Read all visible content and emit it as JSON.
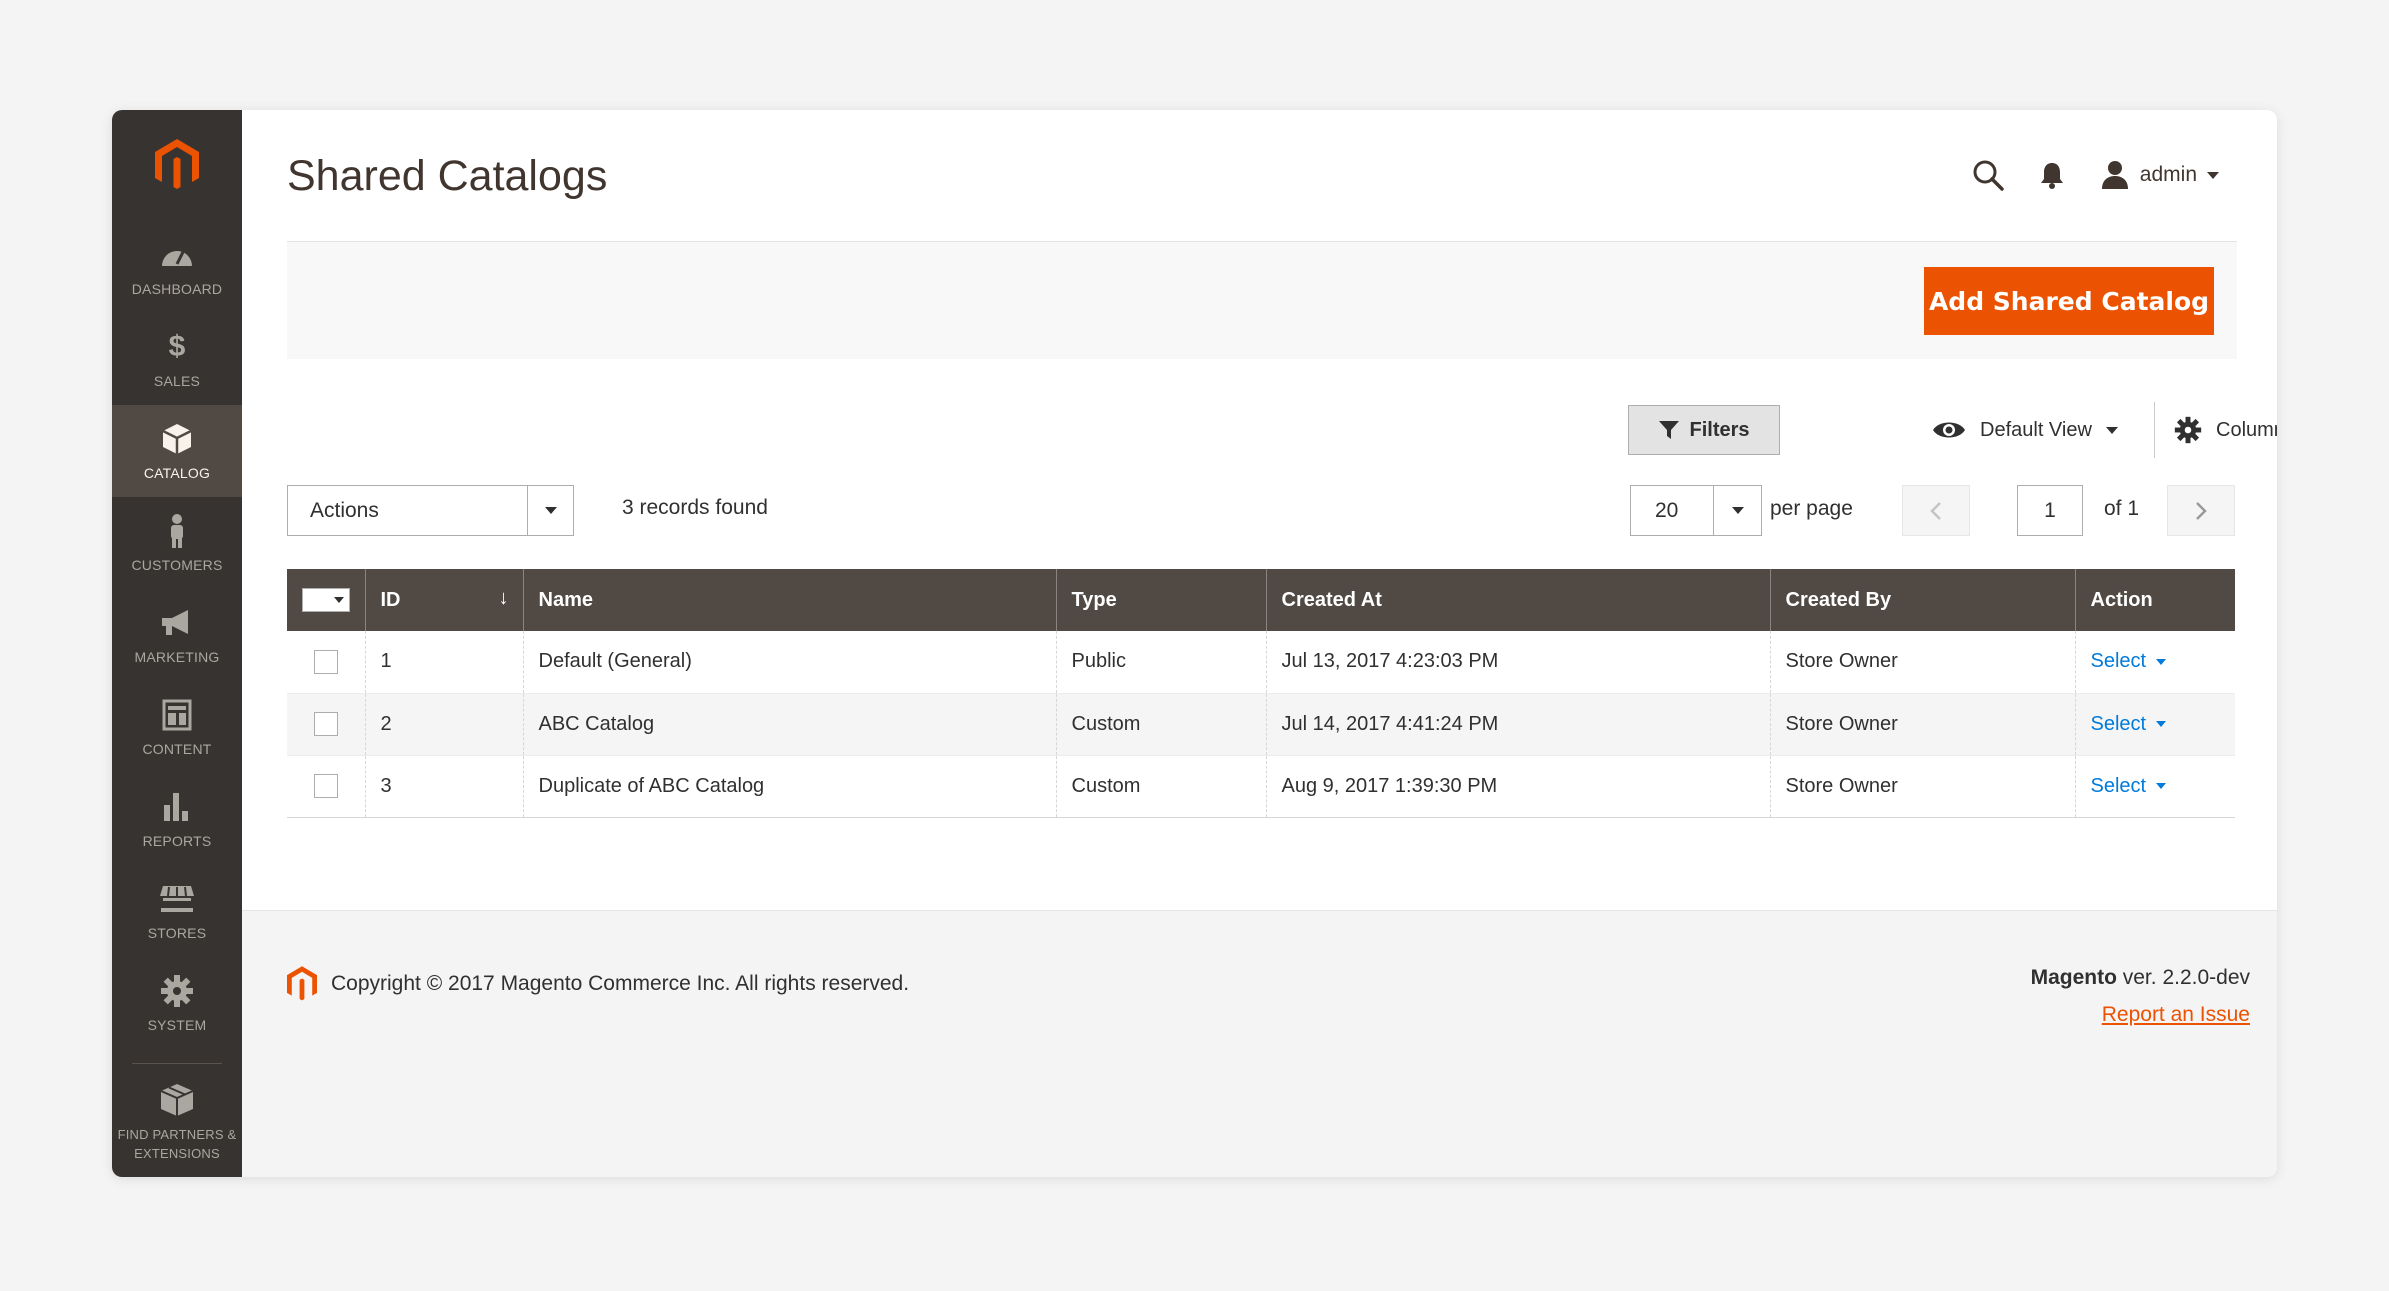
{
  "page": {
    "title": "Shared Catalogs"
  },
  "header": {
    "user": "admin"
  },
  "sidebar": {
    "items": [
      {
        "label": "Dashboard",
        "icon": "dashboard-icon"
      },
      {
        "label": "Sales",
        "icon": "dollar-icon"
      },
      {
        "label": "Catalog",
        "icon": "box-icon",
        "active": true
      },
      {
        "label": "Customers",
        "icon": "person-icon"
      },
      {
        "label": "Marketing",
        "icon": "megaphone-icon"
      },
      {
        "label": "Content",
        "icon": "layout-icon"
      },
      {
        "label": "Reports",
        "icon": "bar-chart-icon"
      },
      {
        "label": "Stores",
        "icon": "storefront-icon"
      },
      {
        "label": "System",
        "icon": "gear-icon"
      },
      {
        "label": "Find Partners & Extensions",
        "icon": "cubes-icon"
      }
    ]
  },
  "toolbar": {
    "add_button": "Add Shared Catalog",
    "filters": "Filters",
    "default_view": "Default View",
    "columns": "Columns",
    "actions": "Actions",
    "records_found": "3 records found",
    "per_page_value": "20",
    "per_page_label": "per page",
    "current_page": "1",
    "page_of": "of 1"
  },
  "grid": {
    "columns": [
      "ID",
      "Name",
      "Type",
      "Created At",
      "Created By",
      "Action"
    ],
    "rows": [
      {
        "id": "1",
        "name": "Default (General)",
        "type": "Public",
        "created_at": "Jul 13, 2017 4:23:03 PM",
        "created_by": "Store Owner",
        "action": "Select"
      },
      {
        "id": "2",
        "name": "ABC Catalog",
        "type": "Custom",
        "created_at": "Jul 14, 2017 4:41:24 PM",
        "created_by": "Store Owner",
        "action": "Select"
      },
      {
        "id": "3",
        "name": "Duplicate of ABC Catalog",
        "type": "Custom",
        "created_at": "Aug 9, 2017 1:39:30 PM",
        "created_by": "Store Owner",
        "action": "Select"
      }
    ]
  },
  "footer": {
    "copyright": "Copyright © 2017 Magento Commerce Inc. All rights reserved.",
    "brand": "Magento",
    "version": " ver. 2.2.0-dev",
    "report_link": "Report an Issue"
  },
  "colors": {
    "accent": "#eb5202",
    "sidebar": "#373330",
    "grid_header": "#514943",
    "link": "#007bdb"
  }
}
